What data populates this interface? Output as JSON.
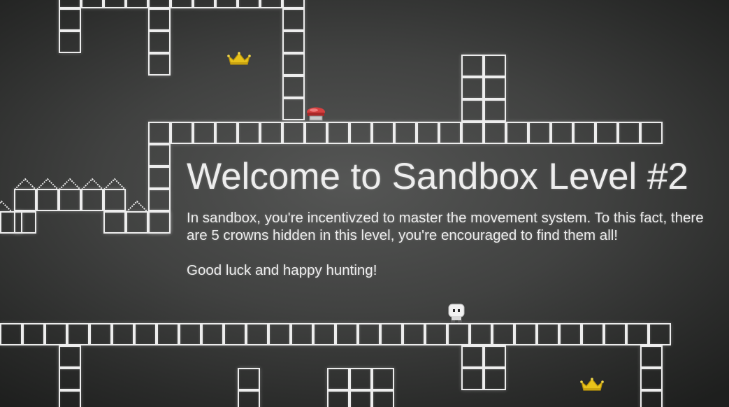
{
  "level": {
    "title": "Welcome to Sandbox Level #2",
    "description": "In sandbox, you're incentivzed to master the movement system. To this fact, there are 5 crowns hidden in this level, you're encouraged to find them all!",
    "sign_off": "Good luck and happy hunting!"
  },
  "entities": {
    "crowns_visible": 2,
    "icons": [
      "crown-icon",
      "switch-button-icon",
      "player-character-icon",
      "spike-icon"
    ]
  },
  "colors": {
    "tile_outline": "#ececec",
    "crown_gold": "#e8c21a",
    "switch_red": "#d64040",
    "background": "#414241"
  }
}
